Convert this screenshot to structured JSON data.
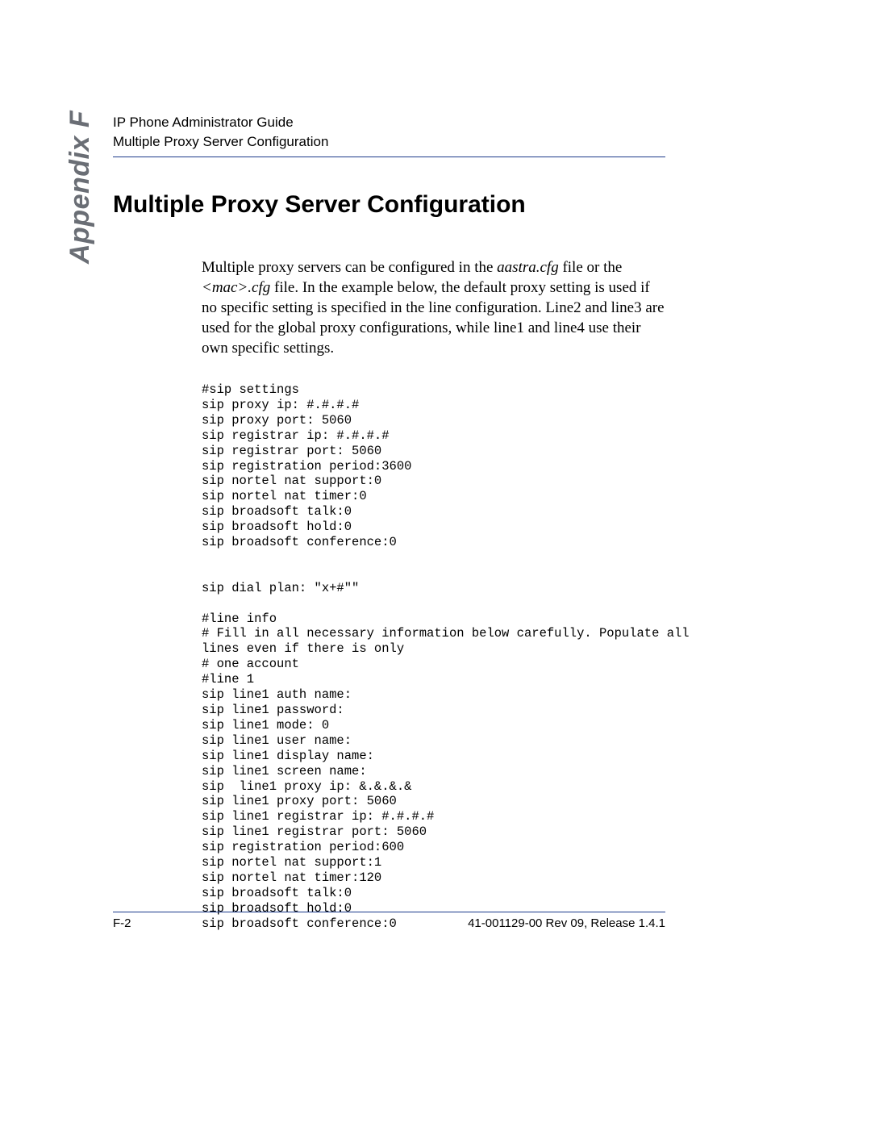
{
  "header": {
    "line1": "IP Phone Administrator Guide",
    "line2": "Multiple Proxy Server Configuration"
  },
  "side_label": "Appendix F",
  "heading": "Multiple Proxy Server Configuration",
  "para": {
    "t1": "Multiple proxy servers can be configured in the ",
    "i1": "aastra.cfg",
    "t2": " file or the ",
    "i2": "<mac>.cfg",
    "t3": " file. In the example below, the default proxy setting is used if no specific setting is specified in the line configuration. Line2 and line3 are used for the global proxy configurations, while line1 and line4 use their own specific settings."
  },
  "code": "#sip settings\nsip proxy ip: #.#.#.#\nsip proxy port: 5060\nsip registrar ip: #.#.#.#\nsip registrar port: 5060\nsip registration period:3600\nsip nortel nat support:0\nsip nortel nat timer:0\nsip broadsoft talk:0\nsip broadsoft hold:0\nsip broadsoft conference:0\n\n\nsip dial plan: \"x+#\"\"\n\n#line info\n# Fill in all necessary information below carefully. Populate all \nlines even if there is only\n# one account\n#line 1\nsip line1 auth name: \nsip line1 password: \nsip line1 mode: 0\nsip line1 user name: \nsip line1 display name: \nsip line1 screen name: \nsip  line1 proxy ip: &.&.&.& \nsip line1 proxy port: 5060\nsip line1 registrar ip: #.#.#.# \nsip line1 registrar port: 5060\nsip registration period:600\nsip nortel nat support:1\nsip nortel nat timer:120\nsip broadsoft talk:0\nsip broadsoft hold:0\nsip broadsoft conference:0",
  "footer": {
    "left": "F-2",
    "right": "41-001129-00 Rev 09, Release 1.4.1"
  }
}
